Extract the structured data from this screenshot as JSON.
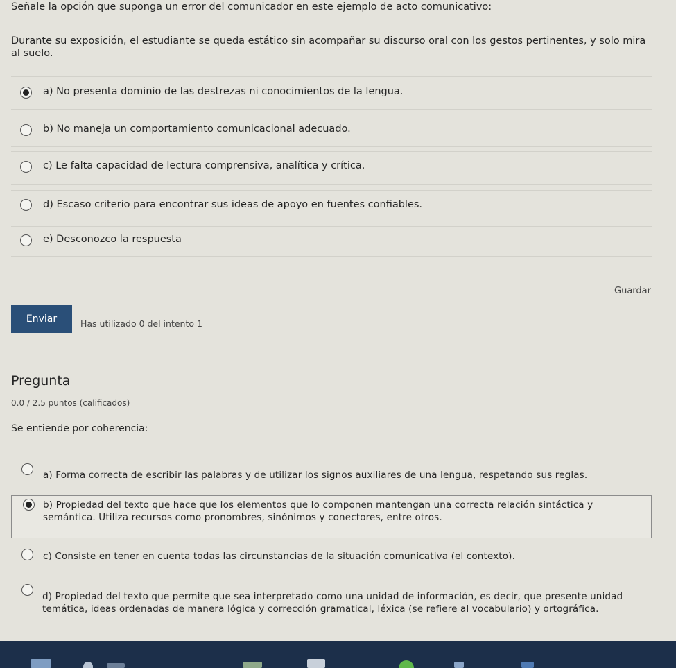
{
  "question1": {
    "prompt": "Señale la opción que suponga un error del comunicador en este ejemplo de acto comunicativo:",
    "stem": "Durante su exposición, el estudiante se queda estático sin acompañar su discurso oral con los gestos pertinentes, y solo mira al suelo.",
    "options": [
      {
        "label": "a) No presenta dominio de las destrezas ni conocimientos de la lengua.",
        "checked": true
      },
      {
        "label": "b) No maneja un comportamiento comunicacional adecuado.",
        "checked": false
      },
      {
        "label": "c) Le falta capacidad de lectura comprensiva, analítica y crítica.",
        "checked": false
      },
      {
        "label": "d) Escaso criterio para encontrar sus ideas de apoyo en fuentes confiables.",
        "checked": false
      },
      {
        "label": "e) Desconozco la respuesta",
        "checked": false
      }
    ],
    "save_label": "Guardar"
  },
  "submit": {
    "button_label": "Enviar",
    "attempts_text": "Has utilizado 0 del intento 1"
  },
  "question2": {
    "heading": "Pregunta",
    "points": "0.0 / 2.5 puntos (calificados)",
    "stem": "Se entiende por coherencia:",
    "options": [
      {
        "label": "a) Forma correcta de escribir las palabras y de utilizar los signos auxiliares de una lengua, respetando sus reglas.",
        "checked": false
      },
      {
        "label": "b) Propiedad del texto que hace que los elementos que lo componen mantengan una correcta relación sintáctica y semántica. Utiliza recursos como pronombres, sinónimos y conectores, entre otros.",
        "checked": true
      },
      {
        "label": "c) Consiste en tener en cuenta todas las circunstancias de la situación comunicativa (el contexto).",
        "checked": false
      },
      {
        "label": "d) Propiedad del texto que permite que sea interpretado como una unidad de información, es decir, que presente unidad temática, ideas ordenadas de manera lógica y corrección gramatical, léxica (se refiere al vocabulario) y ortográfica.",
        "checked": false
      }
    ]
  },
  "colors": {
    "page_bg": "#e4e3dc",
    "button_bg": "#2a4f78",
    "taskbar_bg": "#1c2f4a"
  }
}
